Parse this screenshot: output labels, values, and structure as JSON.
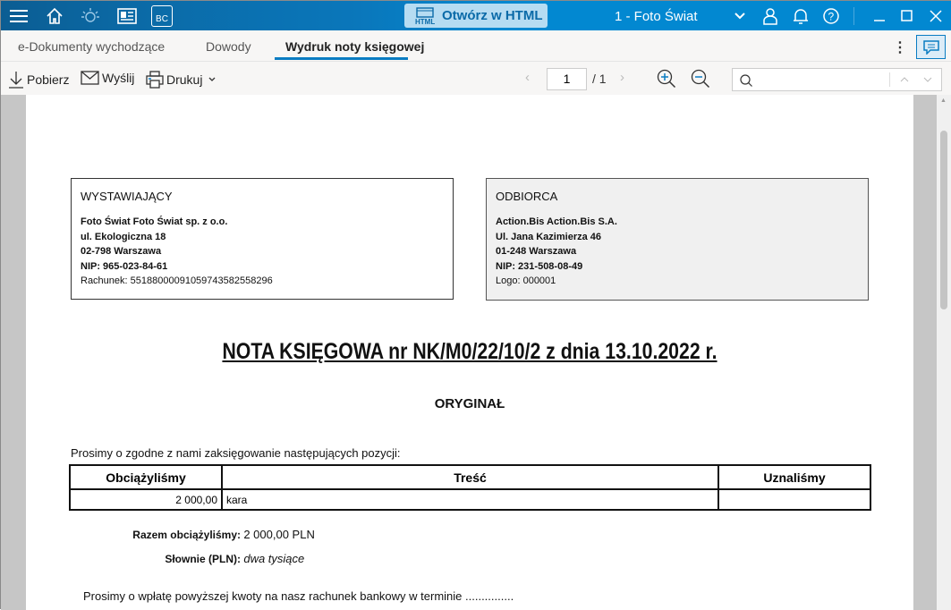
{
  "titlebar": {
    "open_html": "Otwórz w HTML",
    "html_badge": "HTML",
    "bc_badge": "BC",
    "company": "1 - Foto Świat"
  },
  "tabs": [
    {
      "label": "e-Dokumenty wychodzące"
    },
    {
      "label": "Dowody"
    },
    {
      "label": "Wydruk noty księgowej"
    }
  ],
  "toolbar": {
    "download": "Pobierz",
    "send": "Wyślij",
    "print": "Drukuj",
    "page_current": "1",
    "page_total": "/ 1",
    "search_placeholder": ""
  },
  "document": {
    "issuer": {
      "heading": "WYSTAWIAJĄCY",
      "name": "Foto Świat Foto Świat sp. z o.o.",
      "street": "ul. Ekologiczna 18",
      "city": "02-798  Warszawa",
      "nip": "NIP: 965-023-84-61",
      "account": "Rachunek: 55188000091059743582558296"
    },
    "recipient": {
      "heading": "ODBIORCA",
      "name": "Action.Bis Action.Bis S.A.",
      "street": "Ul. Jana Kazimierza 46",
      "city": "01-248  Warszawa",
      "nip": "NIP: 231-508-08-49",
      "logo": "Logo: 000001"
    },
    "title": "NOTA KSIĘGOWA nr NK/M0/22/10/2 z dnia 13.10.2022 r.",
    "copy": "ORYGINAŁ",
    "intro": "Prosimy o zgodne z nami zaksięgowanie następujących pozycji:",
    "table": {
      "headers": [
        "Obciążyliśmy",
        "Treść",
        "Uznaliśmy"
      ],
      "rows": [
        {
          "debit": "2 000,00",
          "content": "kara",
          "credit": ""
        }
      ]
    },
    "total_label": "Razem obciążyliśmy:",
    "total_value": "2 000,00 PLN",
    "words_label": "Słownie (PLN):",
    "words_value": "dwa tysiące",
    "payment": "Prosimy o wpłatę powyższej kwoty na nasz rachunek bankowy w terminie  ..............."
  }
}
